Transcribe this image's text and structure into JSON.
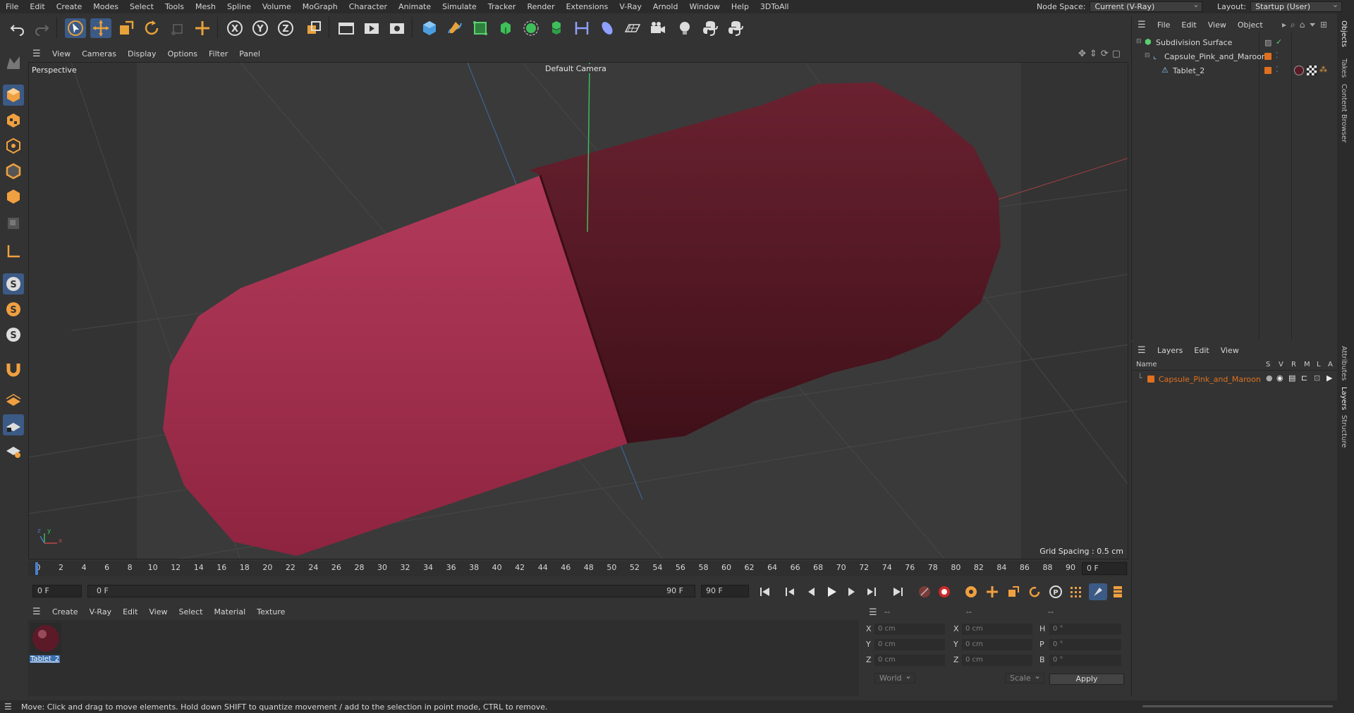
{
  "menu": {
    "items": [
      "File",
      "Edit",
      "Create",
      "Modes",
      "Select",
      "Tools",
      "Mesh",
      "Spline",
      "Volume",
      "MoGraph",
      "Character",
      "Animate",
      "Simulate",
      "Tracker",
      "Render",
      "Extensions",
      "V-Ray",
      "Arnold",
      "Window",
      "Help",
      "3DToAll"
    ],
    "node_space_label": "Node Space:",
    "node_space_value": "Current (V-Ray)",
    "layout_label": "Layout:",
    "layout_value": "Startup (User)"
  },
  "viewport": {
    "menu": [
      "View",
      "Cameras",
      "Display",
      "Options",
      "Filter",
      "Panel"
    ],
    "name": "Perspective",
    "camera": "Default Camera",
    "grid_spacing": "Grid Spacing : 0.5 cm",
    "axis_labels": {
      "x": "x",
      "y": "y",
      "z": "z"
    }
  },
  "timeline": {
    "ticks": [
      "0",
      "2",
      "4",
      "6",
      "8",
      "10",
      "12",
      "14",
      "16",
      "18",
      "20",
      "22",
      "24",
      "26",
      "28",
      "30",
      "32",
      "34",
      "36",
      "38",
      "40",
      "42",
      "44",
      "46",
      "48",
      "50",
      "52",
      "54",
      "56",
      "58",
      "60",
      "62",
      "64",
      "66",
      "68",
      "70",
      "72",
      "74",
      "76",
      "78",
      "80",
      "82",
      "84",
      "86",
      "88",
      "90"
    ],
    "current_frame_right": "0 F",
    "start_field": "0 F",
    "range_start": "0 F",
    "range_end": "90 F",
    "end_field": "90 F"
  },
  "material_manager": {
    "menu": [
      "Create",
      "V-Ray",
      "Edit",
      "View",
      "Select",
      "Material",
      "Texture"
    ],
    "materials": [
      {
        "name": "Tablet_2"
      }
    ]
  },
  "coordinates": {
    "headers": [
      "--",
      "--",
      "--"
    ],
    "rows": [
      {
        "a_label": "X",
        "a_value": "0 cm",
        "b_label": "X",
        "b_value": "0 cm",
        "c_label": "H",
        "c_value": "0 °"
      },
      {
        "a_label": "Y",
        "a_value": "0 cm",
        "b_label": "Y",
        "b_value": "0 cm",
        "c_label": "P",
        "c_value": "0 °"
      },
      {
        "a_label": "Z",
        "a_value": "0 cm",
        "b_label": "Z",
        "b_value": "0 cm",
        "c_label": "B",
        "c_value": "0 °"
      }
    ],
    "space_value": "World",
    "mode_value": "Scale",
    "apply_label": "Apply"
  },
  "object_manager": {
    "menu": [
      "File",
      "Edit",
      "View",
      "Object"
    ],
    "objects": [
      {
        "name": "Subdivision Surface"
      },
      {
        "name": "Capsule_Pink_and_Maroon"
      },
      {
        "name": "Tablet_2"
      }
    ]
  },
  "layer_manager": {
    "menu": [
      "Layers",
      "Edit",
      "View"
    ],
    "columns": {
      "name": "Name",
      "flags": [
        "S",
        "V",
        "R",
        "M",
        "L",
        "A"
      ]
    },
    "layers": [
      {
        "name": "Capsule_Pink_and_Maroon"
      }
    ]
  },
  "side_tabs": [
    "Objects",
    "Takes",
    "Content Browser",
    "Attributes",
    "Layers",
    "Structure"
  ],
  "status_text": "Move: Click and drag to move elements. Hold down SHIFT to quantize movement / add to the selection in point mode, CTRL to remove.",
  "colors": {
    "accent_orange": "#e0701e",
    "capsule_pink": "#a8304f",
    "capsule_maroon": "#5c1a28",
    "selected_blue": "#3b6fb0"
  }
}
